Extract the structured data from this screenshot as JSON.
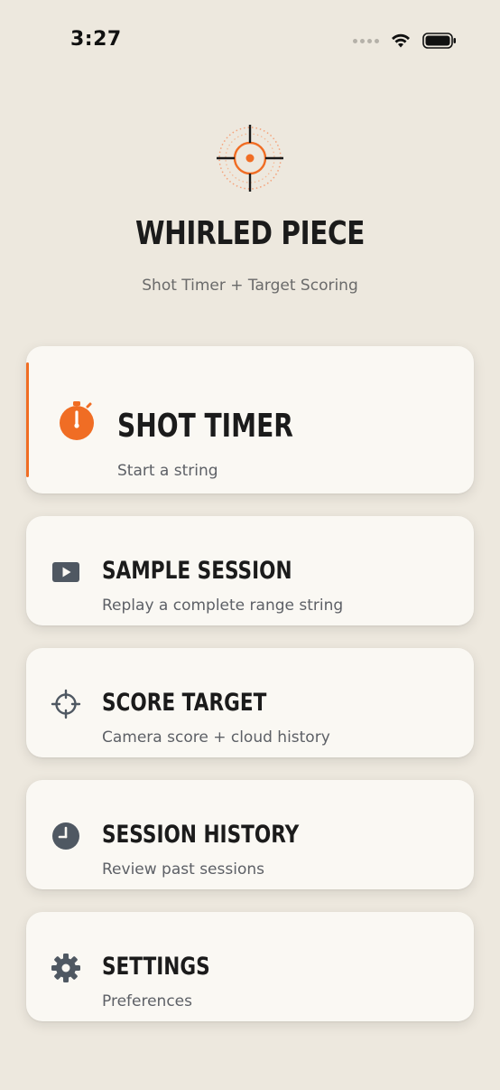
{
  "status_bar": {
    "time": "3:27"
  },
  "header": {
    "title": "WHIRLED PIECE",
    "subtitle": "Shot Timer + Target Scoring",
    "logo_icon": "crosshair-target-icon"
  },
  "colors": {
    "accent": "#f06d24",
    "background": "#ede8de",
    "card": "#faf8f3",
    "icon_gray": "#4f5862"
  },
  "menu": {
    "items": [
      {
        "title": "SHOT TIMER",
        "subtitle": "Start a string",
        "icon": "stopwatch-icon"
      },
      {
        "title": "SAMPLE SESSION",
        "subtitle": "Replay a complete range string",
        "icon": "play-icon"
      },
      {
        "title": "SCORE TARGET",
        "subtitle": "Camera score + cloud history",
        "icon": "crosshair-icon"
      },
      {
        "title": "SESSION HISTORY",
        "subtitle": "Review past sessions",
        "icon": "clock-icon"
      },
      {
        "title": "SETTINGS",
        "subtitle": "Preferences",
        "icon": "gear-icon"
      }
    ]
  }
}
